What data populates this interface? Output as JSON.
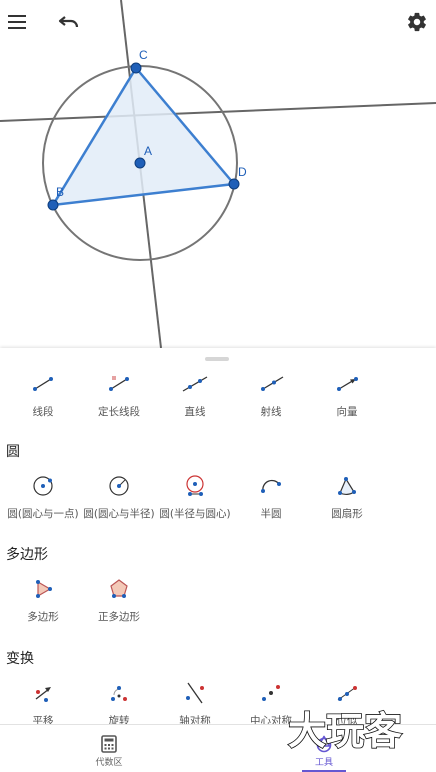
{
  "toolbar": {
    "menu_icon": "hamburger-menu-icon",
    "undo_icon": "undo-icon",
    "settings_icon": "gear-icon"
  },
  "construction": {
    "points": [
      {
        "label": "C"
      },
      {
        "label": "A"
      },
      {
        "label": "B"
      },
      {
        "label": "D"
      }
    ],
    "colors": {
      "point": "#1f5fb8",
      "polygon_stroke": "#3d7fd0",
      "polygon_fill": "#e2ecf8",
      "line": "#666666",
      "circle": "#757575"
    }
  },
  "tools_panel": {
    "basic_row": [
      {
        "label": "线段",
        "icon": "segment-icon"
      },
      {
        "label": "定长线段",
        "icon": "segment-fixed-length-icon"
      },
      {
        "label": "直线",
        "icon": "line-icon"
      },
      {
        "label": "射线",
        "icon": "ray-icon"
      },
      {
        "label": "向量",
        "icon": "vector-icon"
      }
    ],
    "sections": {
      "circle": "圆",
      "polygon": "多边形",
      "transform": "变换"
    },
    "circle_row": [
      {
        "label": "圆(圆心与一点)",
        "icon": "circle-center-point-icon"
      },
      {
        "label": "圆(圆心与半径)",
        "icon": "circle-center-radius-icon"
      },
      {
        "label": "圆(半径与圆心)",
        "icon": "compass-icon"
      },
      {
        "label": "半圆",
        "icon": "semicircle-icon"
      },
      {
        "label": "圆扇形",
        "icon": "circular-sector-icon"
      }
    ],
    "polygon_row": [
      {
        "label": "多边形",
        "icon": "polygon-icon"
      },
      {
        "label": "正多边形",
        "icon": "regular-polygon-icon"
      }
    ],
    "transform_row": [
      {
        "label": "平移",
        "icon": "translate-icon"
      },
      {
        "label": "旋转",
        "icon": "rotate-icon"
      },
      {
        "label": "轴对称",
        "icon": "reflect-line-icon"
      },
      {
        "label": "中心对称",
        "icon": "reflect-point-icon"
      },
      {
        "label": "位似",
        "icon": "dilate-icon"
      }
    ]
  },
  "bottom_nav": {
    "algebra_label": "代数区",
    "tools_label": "工具",
    "active_tab": "tools",
    "accent": "#6557d2"
  },
  "watermark": {
    "text": "大玩客"
  }
}
